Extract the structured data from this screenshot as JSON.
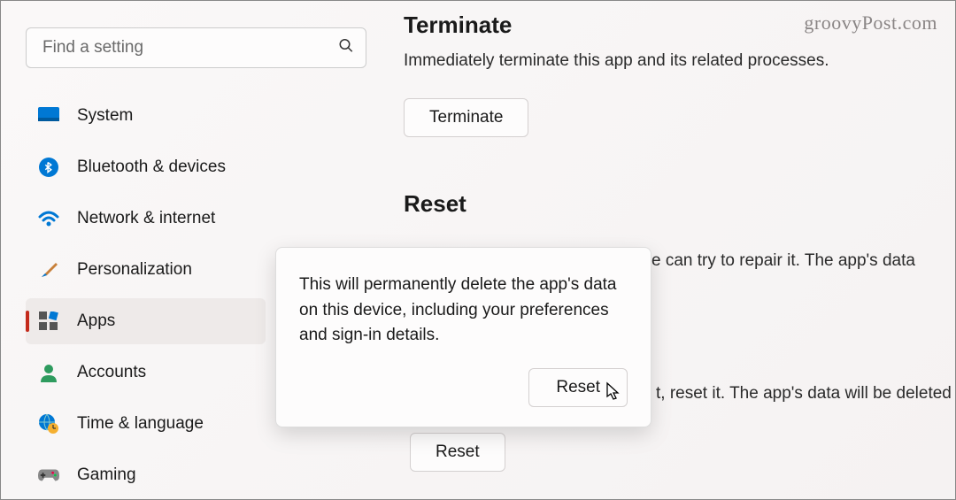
{
  "watermark": "groovyPost.com",
  "search": {
    "placeholder": "Find a setting"
  },
  "nav": {
    "system": "System",
    "bluetooth": "Bluetooth & devices",
    "network": "Network & internet",
    "personalization": "Personalization",
    "apps": "Apps",
    "accounts": "Accounts",
    "time": "Time & language",
    "gaming": "Gaming"
  },
  "terminate": {
    "title": "Terminate",
    "desc": "Immediately terminate this app and its related processes.",
    "button": "Terminate"
  },
  "reset": {
    "title": "Reset",
    "partial_repair": "e can try to repair it. The app's data",
    "partial_reset": "t, reset it. The app's data will be deleted",
    "button": "Reset"
  },
  "popup": {
    "text": "This will permanently delete the app's data on this device, including your preferences and sign-in details.",
    "confirm": "Reset"
  }
}
